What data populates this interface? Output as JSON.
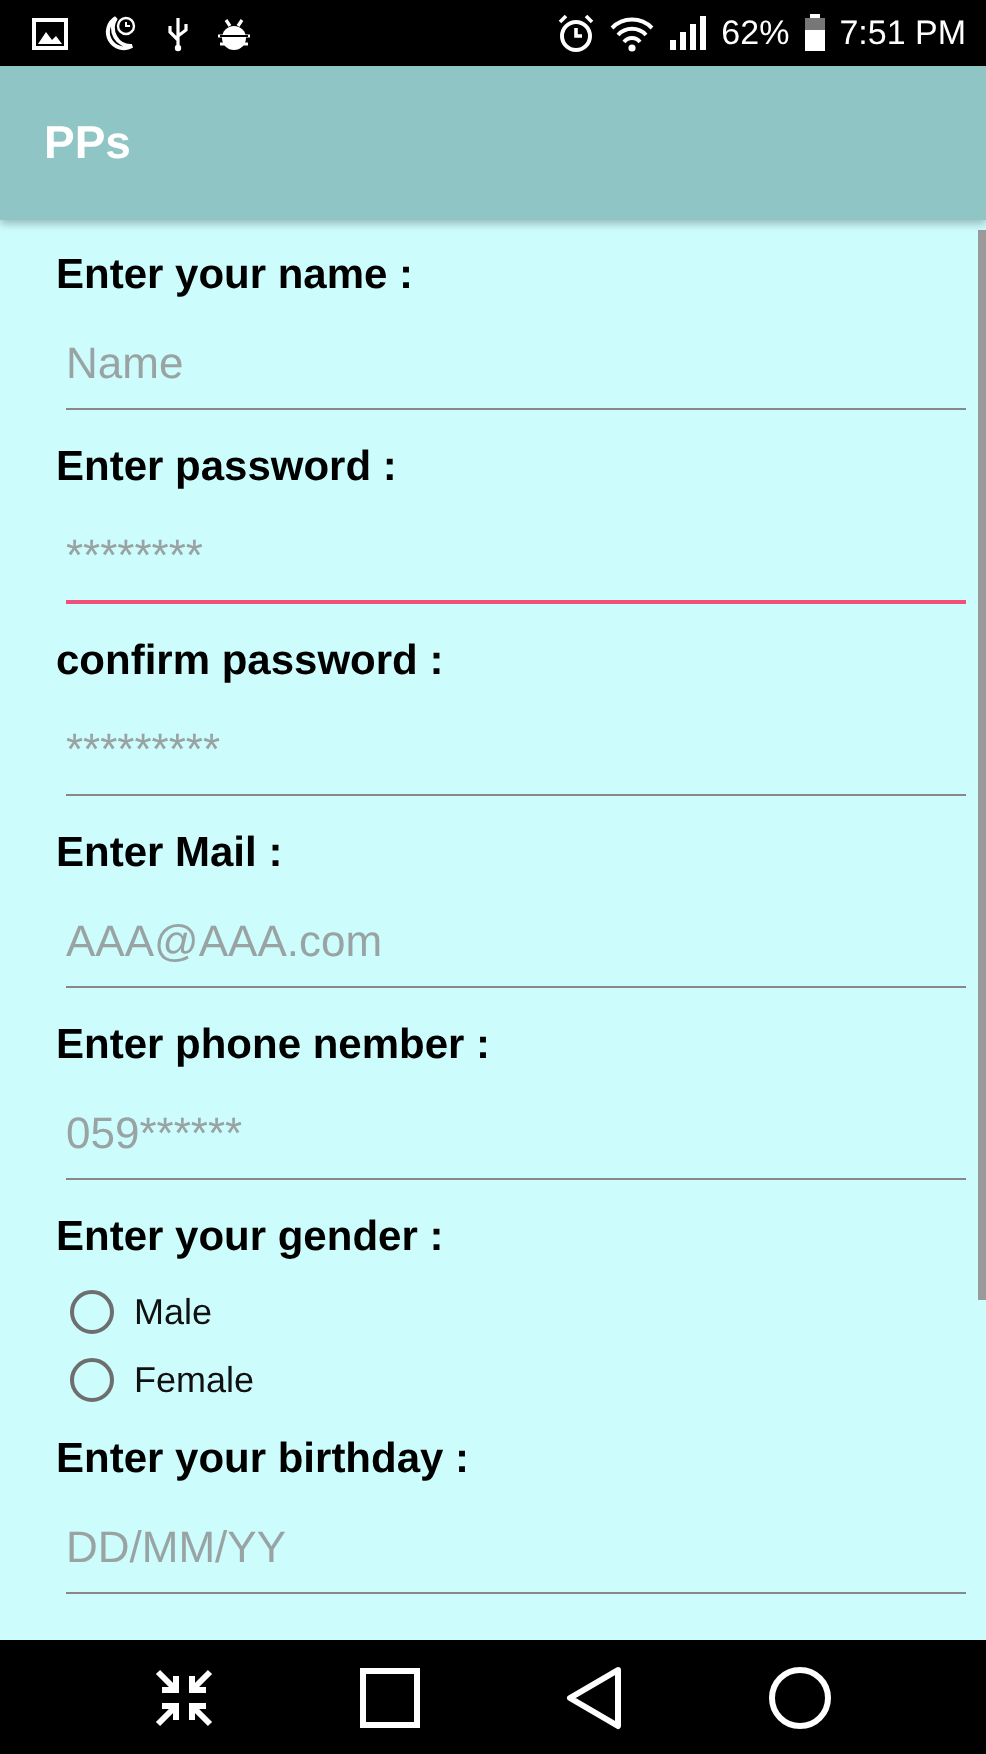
{
  "status_bar": {
    "battery": "62%",
    "time": "7:51 PM"
  },
  "app_bar": {
    "title": "PPs"
  },
  "form": [
    {
      "kind": "field",
      "label": "Enter your name :",
      "placeholder": "Name",
      "focused": false
    },
    {
      "kind": "field",
      "label": "Enter password :",
      "placeholder": "********",
      "focused": true
    },
    {
      "kind": "field",
      "label": "confirm password :",
      "placeholder": "*********",
      "focused": false
    },
    {
      "kind": "field",
      "label": "Enter Mail :",
      "placeholder": "AAA@AAA.com",
      "focused": false
    },
    {
      "kind": "field",
      "label": "Enter phone nember :",
      "placeholder": "059******",
      "focused": false
    },
    {
      "kind": "radio_group",
      "label": "Enter your gender :",
      "options": [
        {
          "label": "Male",
          "selected": false
        },
        {
          "label": "Female",
          "selected": false
        }
      ]
    },
    {
      "kind": "field",
      "label": "Enter your birthday :",
      "placeholder": "DD/MM/YY",
      "focused": false
    }
  ]
}
